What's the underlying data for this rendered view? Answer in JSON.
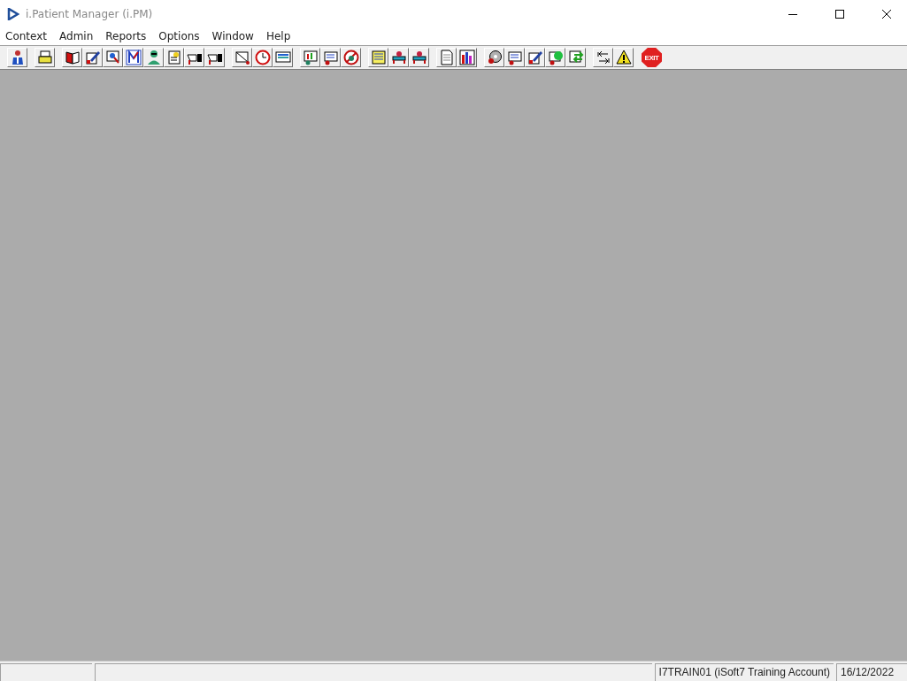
{
  "window": {
    "title": "i.Patient Manager (i.PM)"
  },
  "menu": [
    "Context",
    "Admin",
    "Reports",
    "Options",
    "Window",
    "Help"
  ],
  "toolbar": [
    [
      {
        "kind": "person"
      }
    ],
    [
      {
        "kind": "printer"
      }
    ],
    [
      {
        "kind": "book"
      },
      {
        "kind": "edit"
      },
      {
        "kind": "search"
      },
      {
        "kind": "letter"
      },
      {
        "kind": "doctor"
      },
      {
        "kind": "note"
      },
      {
        "kind": "pointer"
      },
      {
        "kind": "pointer"
      }
    ],
    [
      {
        "kind": "scan"
      },
      {
        "kind": "clock"
      },
      {
        "kind": "screen"
      }
    ],
    [
      {
        "kind": "chart"
      },
      {
        "kind": "form"
      },
      {
        "kind": "nobed"
      }
    ],
    [
      {
        "kind": "list"
      },
      {
        "kind": "bed"
      },
      {
        "kind": "bed"
      }
    ],
    [
      {
        "kind": "page"
      },
      {
        "kind": "bars"
      }
    ],
    [
      {
        "kind": "disc"
      },
      {
        "kind": "form"
      },
      {
        "kind": "edit"
      },
      {
        "kind": "globe"
      },
      {
        "kind": "swap"
      }
    ],
    [
      {
        "kind": "arrows"
      },
      {
        "kind": "warning"
      }
    ],
    [
      {
        "kind": "exit",
        "label": "EXIT"
      }
    ]
  ],
  "status_bar": {
    "user": "I7TRAIN01 (iSoft7 Training Account)",
    "date": "16/12/2022"
  }
}
